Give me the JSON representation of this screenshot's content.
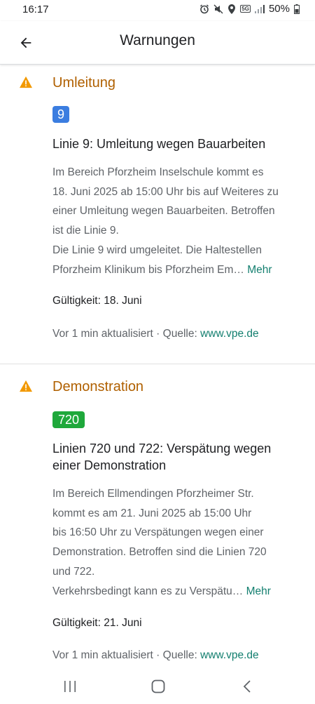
{
  "status_bar": {
    "time": "16:17",
    "network": "5G",
    "battery": "50%",
    "icons": [
      "alarm-icon",
      "mute-icon",
      "location-icon",
      "5g-icon",
      "signal-icon",
      "battery-icon"
    ]
  },
  "app_bar": {
    "back_icon": "arrow-left-icon",
    "title": "Warnungen"
  },
  "alerts": [
    {
      "icon": "warning-icon",
      "type": "Umleitung",
      "line_badge": "9",
      "line_badge_color": "#3b7de0",
      "heading": "Linie 9: Umleitung wegen Bauarbeiten",
      "body_lines": [
        "Im Bereich Pforzheim Inselschule kommt es",
        "18. Juni 2025 ab 15:00 Uhr bis auf Weiteres zu",
        "einer Umleitung wegen Bauarbeiten. Betroffen",
        "ist die Linie 9.",
        "Die Linie 9 wird umgeleitet. Die Haltestellen",
        "Pforzheim Klinikum bis Pforzheim Em…"
      ],
      "more": "Mehr",
      "validity": "Gültigkeit: 18. Juni",
      "updated": "Vor 1 min aktualisiert · Quelle: ",
      "source": "www.vpe.de"
    },
    {
      "icon": "warning-icon",
      "type": "Demonstration",
      "line_badge": "720",
      "line_badge_color": "#1fa83b",
      "heading": "Linien 720 und 722: Verspätung wegen einer Demonstration",
      "body_lines": [
        "Im Bereich Ellmendingen Pforzheimer Str.",
        "kommt es am 21. Juni 2025 ab 15:00 Uhr",
        "bis 16:50 Uhr zu Verspätungen wegen einer",
        "Demonstration. Betroffen sind die Linien 720",
        "und 722.",
        "Verkehrsbedingt kann es zu Verspätu…"
      ],
      "more": "Mehr",
      "validity": "Gültigkeit: 21. Juni",
      "updated": "Vor 1 min aktualisiert · Quelle: ",
      "source": "www.vpe.de"
    }
  ],
  "nav_bar": {
    "icons": [
      "recents-icon",
      "home-icon",
      "back-icon"
    ]
  },
  "colors": {
    "warning": "#f29900",
    "alert_type": "#b06000",
    "link": "#137f6f"
  }
}
